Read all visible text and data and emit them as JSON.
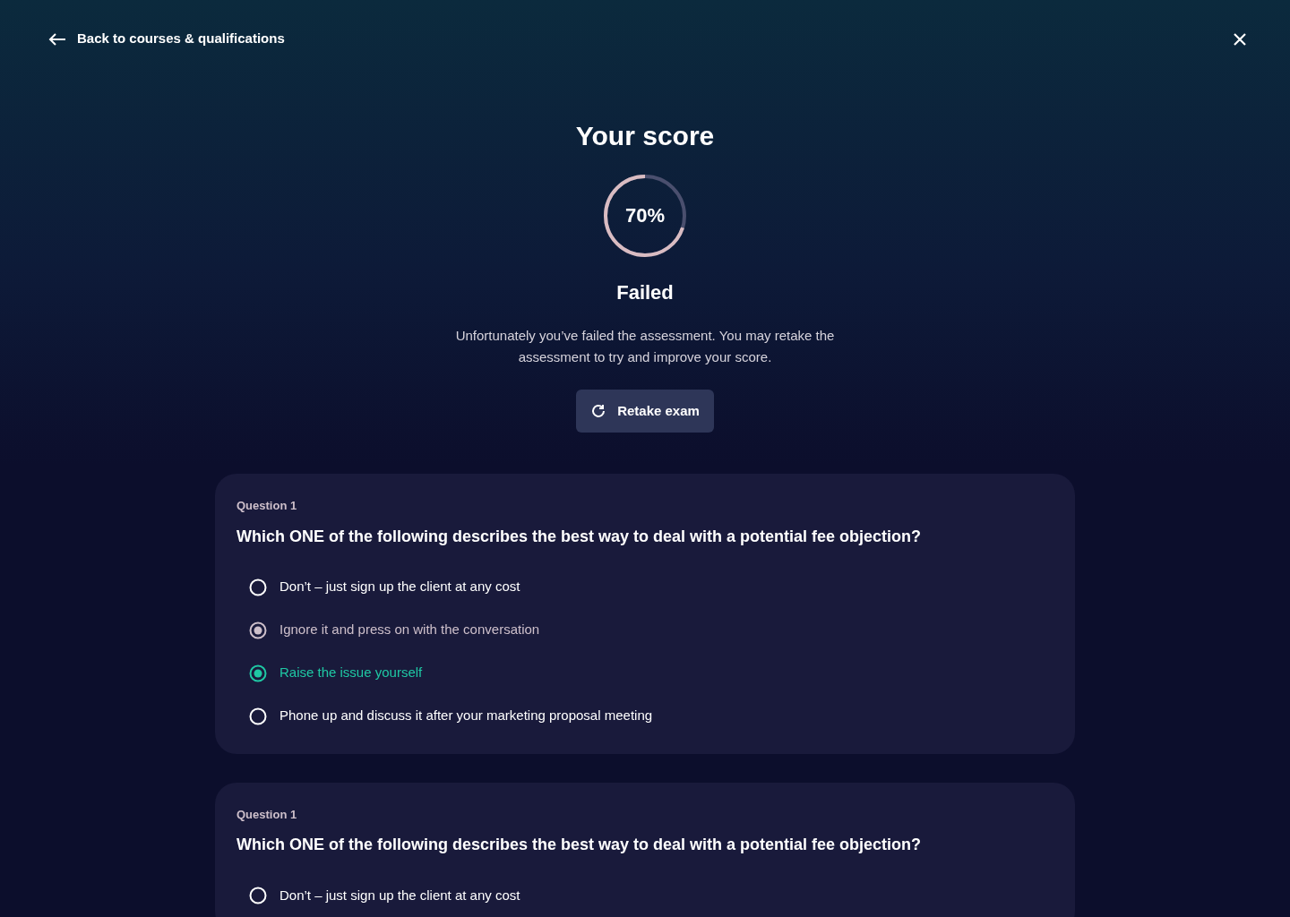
{
  "back_link": {
    "label": "Back to courses & qualifications"
  },
  "result": {
    "title": "Your score",
    "score": "70%",
    "level": 0.7,
    "status": "Failed",
    "message": "Unfortunately you’ve failed the assessment. You may retake the assessment to try and improve your score.",
    "button": "Retake exam"
  },
  "questions": [
    {
      "label": "Question 1",
      "text": "Which ONE of the following describes the best way to deal with a potential fee objection?",
      "options": [
        {
          "label": "Don’t – just sign up the client at any cost",
          "selected": false,
          "correct": false
        },
        {
          "label": "Ignore it and press on with the conversation",
          "selected": true,
          "correct": false
        },
        {
          "label": "Raise the issue yourself",
          "selected": false,
          "correct": true
        },
        {
          "label": "Phone up and discuss it after your marketing proposal meeting",
          "selected": false,
          "correct": false
        }
      ]
    },
    {
      "label": "Question 1",
      "text": "Which ONE of the following describes the best way to deal with a potential fee objection?",
      "options": [
        {
          "label": "Don’t – just sign up the client at any cost",
          "selected": false,
          "correct": false
        }
      ]
    }
  ]
}
